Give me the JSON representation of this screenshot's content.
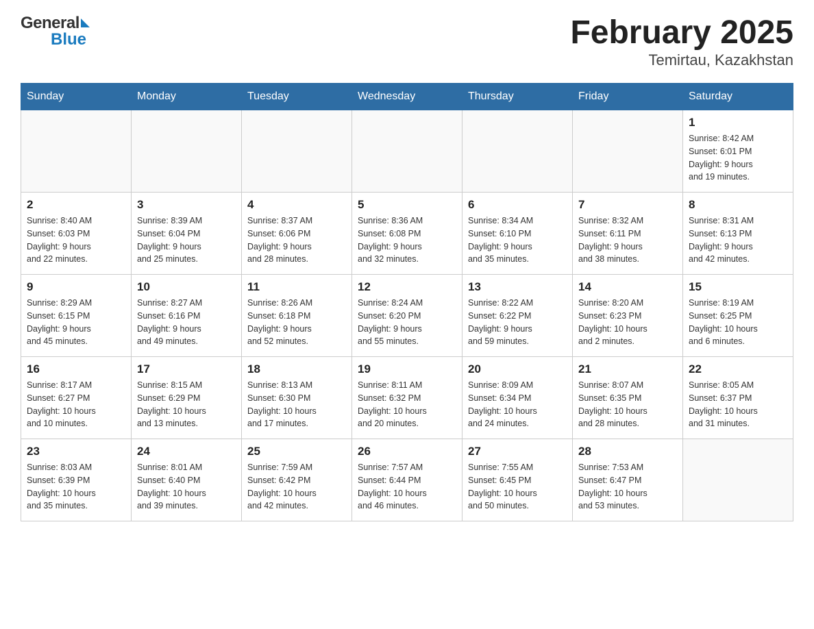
{
  "header": {
    "title": "February 2025",
    "subtitle": "Temirtau, Kazakhstan",
    "logo_general": "General",
    "logo_blue": "Blue"
  },
  "days_of_week": [
    "Sunday",
    "Monday",
    "Tuesday",
    "Wednesday",
    "Thursday",
    "Friday",
    "Saturday"
  ],
  "weeks": [
    {
      "days": [
        {
          "num": "",
          "info": ""
        },
        {
          "num": "",
          "info": ""
        },
        {
          "num": "",
          "info": ""
        },
        {
          "num": "",
          "info": ""
        },
        {
          "num": "",
          "info": ""
        },
        {
          "num": "",
          "info": ""
        },
        {
          "num": "1",
          "info": "Sunrise: 8:42 AM\nSunset: 6:01 PM\nDaylight: 9 hours\nand 19 minutes."
        }
      ]
    },
    {
      "days": [
        {
          "num": "2",
          "info": "Sunrise: 8:40 AM\nSunset: 6:03 PM\nDaylight: 9 hours\nand 22 minutes."
        },
        {
          "num": "3",
          "info": "Sunrise: 8:39 AM\nSunset: 6:04 PM\nDaylight: 9 hours\nand 25 minutes."
        },
        {
          "num": "4",
          "info": "Sunrise: 8:37 AM\nSunset: 6:06 PM\nDaylight: 9 hours\nand 28 minutes."
        },
        {
          "num": "5",
          "info": "Sunrise: 8:36 AM\nSunset: 6:08 PM\nDaylight: 9 hours\nand 32 minutes."
        },
        {
          "num": "6",
          "info": "Sunrise: 8:34 AM\nSunset: 6:10 PM\nDaylight: 9 hours\nand 35 minutes."
        },
        {
          "num": "7",
          "info": "Sunrise: 8:32 AM\nSunset: 6:11 PM\nDaylight: 9 hours\nand 38 minutes."
        },
        {
          "num": "8",
          "info": "Sunrise: 8:31 AM\nSunset: 6:13 PM\nDaylight: 9 hours\nand 42 minutes."
        }
      ]
    },
    {
      "days": [
        {
          "num": "9",
          "info": "Sunrise: 8:29 AM\nSunset: 6:15 PM\nDaylight: 9 hours\nand 45 minutes."
        },
        {
          "num": "10",
          "info": "Sunrise: 8:27 AM\nSunset: 6:16 PM\nDaylight: 9 hours\nand 49 minutes."
        },
        {
          "num": "11",
          "info": "Sunrise: 8:26 AM\nSunset: 6:18 PM\nDaylight: 9 hours\nand 52 minutes."
        },
        {
          "num": "12",
          "info": "Sunrise: 8:24 AM\nSunset: 6:20 PM\nDaylight: 9 hours\nand 55 minutes."
        },
        {
          "num": "13",
          "info": "Sunrise: 8:22 AM\nSunset: 6:22 PM\nDaylight: 9 hours\nand 59 minutes."
        },
        {
          "num": "14",
          "info": "Sunrise: 8:20 AM\nSunset: 6:23 PM\nDaylight: 10 hours\nand 2 minutes."
        },
        {
          "num": "15",
          "info": "Sunrise: 8:19 AM\nSunset: 6:25 PM\nDaylight: 10 hours\nand 6 minutes."
        }
      ]
    },
    {
      "days": [
        {
          "num": "16",
          "info": "Sunrise: 8:17 AM\nSunset: 6:27 PM\nDaylight: 10 hours\nand 10 minutes."
        },
        {
          "num": "17",
          "info": "Sunrise: 8:15 AM\nSunset: 6:29 PM\nDaylight: 10 hours\nand 13 minutes."
        },
        {
          "num": "18",
          "info": "Sunrise: 8:13 AM\nSunset: 6:30 PM\nDaylight: 10 hours\nand 17 minutes."
        },
        {
          "num": "19",
          "info": "Sunrise: 8:11 AM\nSunset: 6:32 PM\nDaylight: 10 hours\nand 20 minutes."
        },
        {
          "num": "20",
          "info": "Sunrise: 8:09 AM\nSunset: 6:34 PM\nDaylight: 10 hours\nand 24 minutes."
        },
        {
          "num": "21",
          "info": "Sunrise: 8:07 AM\nSunset: 6:35 PM\nDaylight: 10 hours\nand 28 minutes."
        },
        {
          "num": "22",
          "info": "Sunrise: 8:05 AM\nSunset: 6:37 PM\nDaylight: 10 hours\nand 31 minutes."
        }
      ]
    },
    {
      "days": [
        {
          "num": "23",
          "info": "Sunrise: 8:03 AM\nSunset: 6:39 PM\nDaylight: 10 hours\nand 35 minutes."
        },
        {
          "num": "24",
          "info": "Sunrise: 8:01 AM\nSunset: 6:40 PM\nDaylight: 10 hours\nand 39 minutes."
        },
        {
          "num": "25",
          "info": "Sunrise: 7:59 AM\nSunset: 6:42 PM\nDaylight: 10 hours\nand 42 minutes."
        },
        {
          "num": "26",
          "info": "Sunrise: 7:57 AM\nSunset: 6:44 PM\nDaylight: 10 hours\nand 46 minutes."
        },
        {
          "num": "27",
          "info": "Sunrise: 7:55 AM\nSunset: 6:45 PM\nDaylight: 10 hours\nand 50 minutes."
        },
        {
          "num": "28",
          "info": "Sunrise: 7:53 AM\nSunset: 6:47 PM\nDaylight: 10 hours\nand 53 minutes."
        },
        {
          "num": "",
          "info": ""
        }
      ]
    }
  ]
}
